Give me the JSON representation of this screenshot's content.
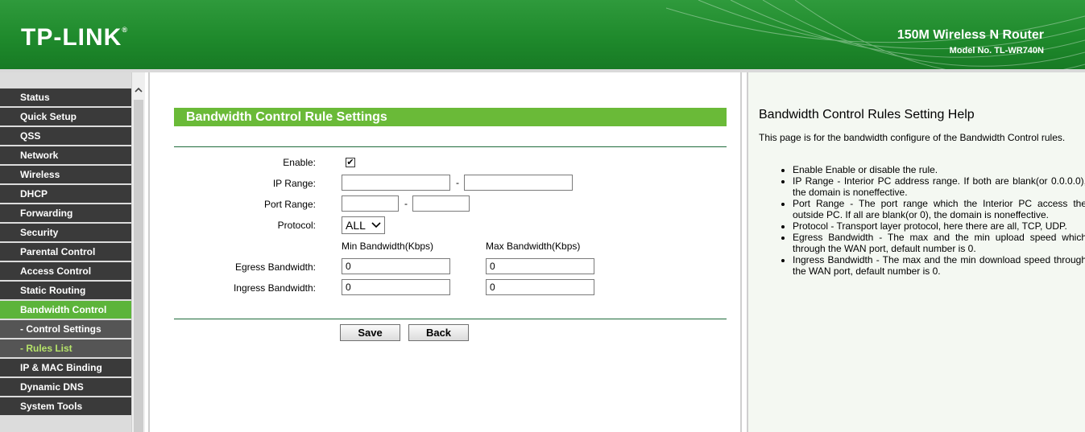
{
  "header": {
    "logo": "TP-LINK",
    "logo_mark": "®",
    "product": "150M Wireless N Router",
    "model": "Model No. TL-WR740N"
  },
  "sidebar": {
    "items": [
      {
        "label": "Status"
      },
      {
        "label": "Quick Setup"
      },
      {
        "label": "QSS"
      },
      {
        "label": "Network"
      },
      {
        "label": "Wireless"
      },
      {
        "label": "DHCP"
      },
      {
        "label": "Forwarding"
      },
      {
        "label": "Security"
      },
      {
        "label": "Parental Control"
      },
      {
        "label": "Access Control"
      },
      {
        "label": "Static Routing"
      },
      {
        "label": "Bandwidth Control"
      },
      {
        "label": "- Control Settings"
      },
      {
        "label": "- Rules List"
      },
      {
        "label": "IP & MAC Binding"
      },
      {
        "label": "Dynamic DNS"
      },
      {
        "label": "System Tools"
      }
    ]
  },
  "main": {
    "title": "Bandwidth Control Rule Settings",
    "enable_label": "Enable:",
    "enable_checked": true,
    "check_glyph": "✔",
    "ip_range_label": "IP Range:",
    "ip_start": "",
    "ip_end": "",
    "port_range_label": "Port Range:",
    "port_start": "",
    "port_end": "",
    "range_separator": "-",
    "protocol_label": "Protocol:",
    "protocol_value": "ALL",
    "min_header": "Min Bandwidth(Kbps)",
    "max_header": "Max Bandwidth(Kbps)",
    "egress_label": "Egress Bandwidth:",
    "egress_min": "0",
    "egress_max": "0",
    "ingress_label": "Ingress Bandwidth:",
    "ingress_min": "0",
    "ingress_max": "0",
    "save_label": "Save",
    "back_label": "Back"
  },
  "help": {
    "title": "Bandwidth Control Rules Setting Help",
    "intro": "This page is for the bandwidth configure of the Bandwidth Control rules.",
    "items": [
      "Enable Enable or disable the rule.",
      "IP Range - Interior PC address range. If both are blank(or 0.0.0.0), the domain is noneffective.",
      "Port Range - The port range which the Interior PC access the outside PC. If all are blank(or 0), the domain is noneffective.",
      "Protocol - Transport layer protocol, here there are all, TCP, UDP.",
      "Egress Bandwidth - The max and the min upload speed which through the WAN port, default number is 0.",
      "Ingress Bandwidth - The max and the min download speed through the WAN port, default number is 0."
    ]
  },
  "colors": {
    "header_green": "#1f8a2c",
    "accent_green": "#6aba38",
    "active_menu": "#5cb43a",
    "menu_bg": "#3a3a3a",
    "submenu_active_text": "#b6e46a"
  },
  "icons": {
    "scroll_up": "chevron-up-icon",
    "select_arrow": "chevron-down-icon",
    "checkbox": "checkmark-icon"
  }
}
